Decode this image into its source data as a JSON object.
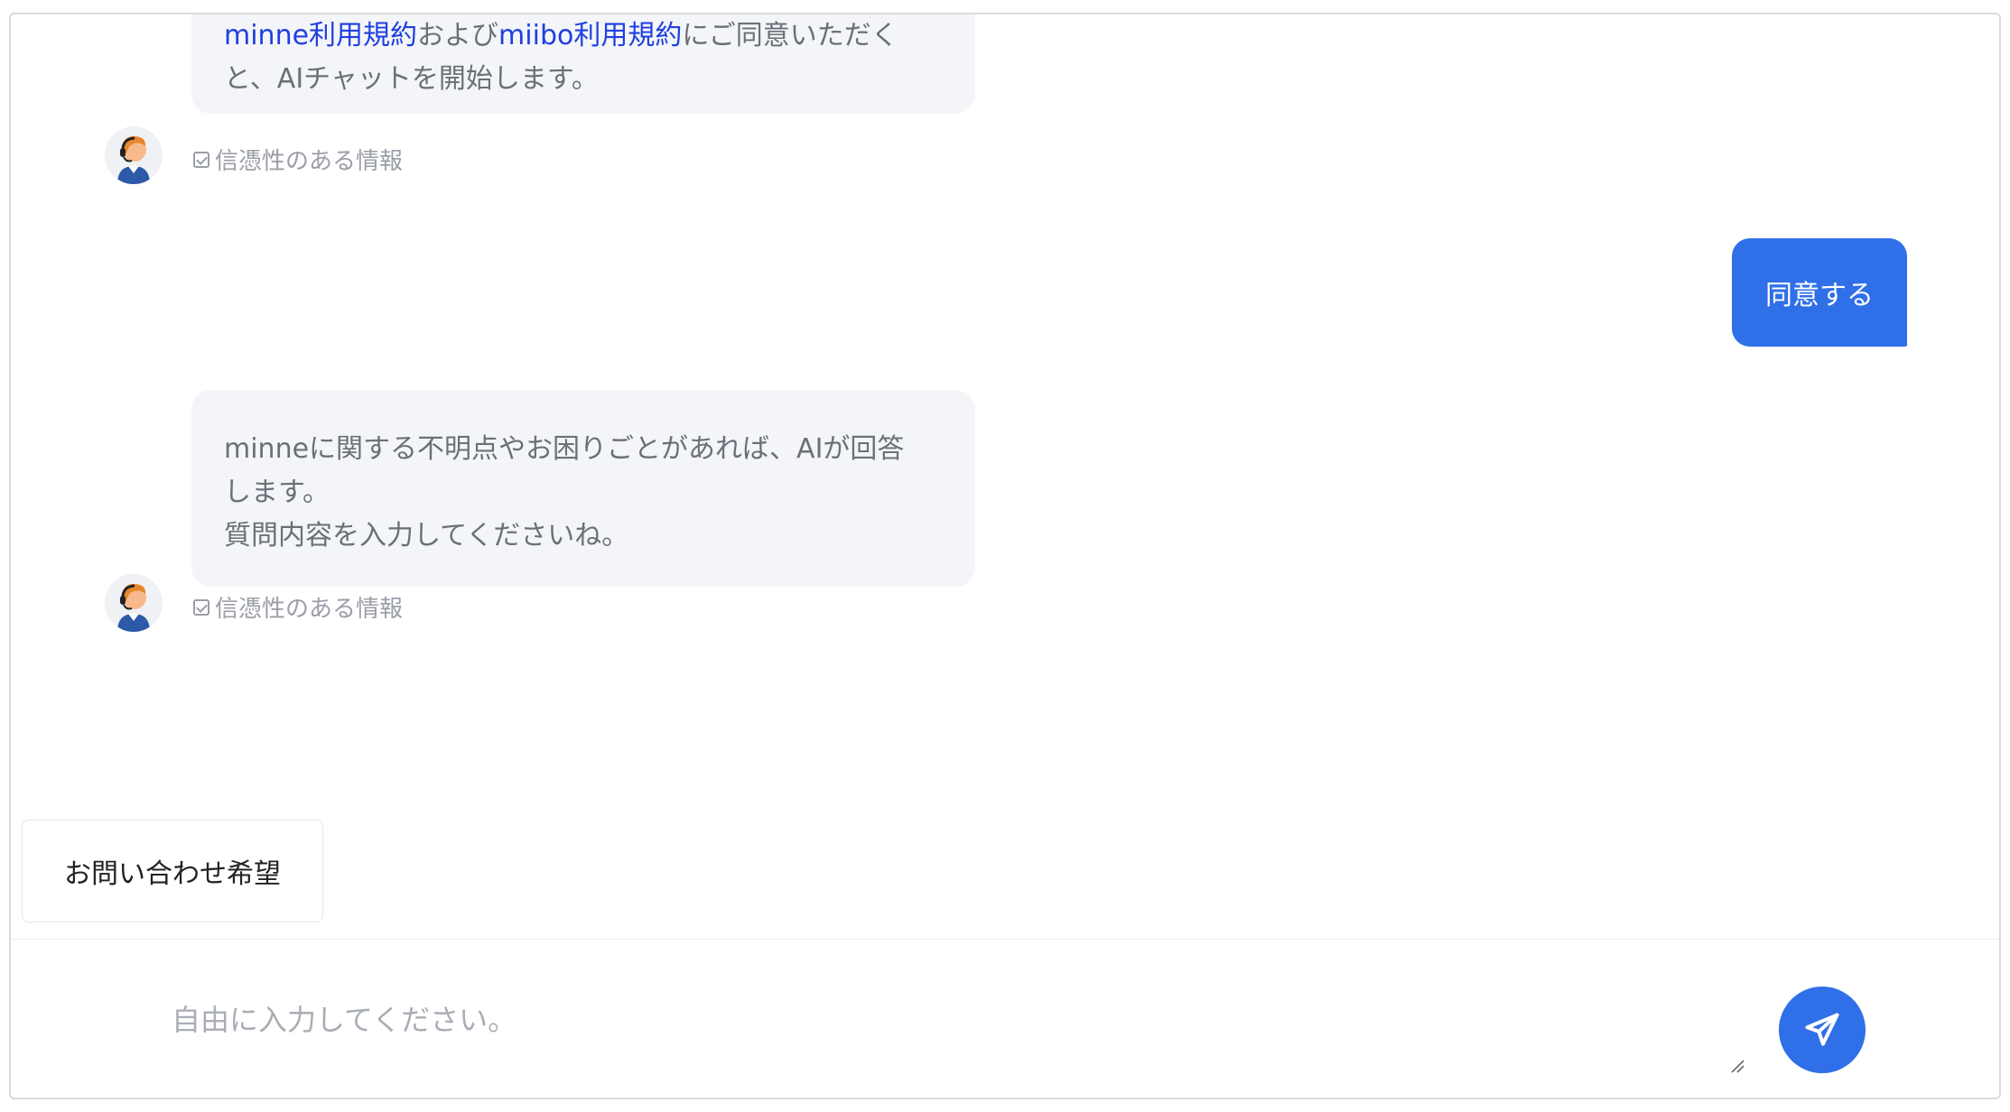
{
  "messages": {
    "bot_1": {
      "link_1": "minne利用規約",
      "text_1": "および",
      "link_2": "miibo利用規約",
      "text_2": "にご同意いただく",
      "line_2": "と、AIチャットを開始します。",
      "credibility": "信憑性のある情報"
    },
    "user_1": {
      "text": "同意する"
    },
    "bot_2": {
      "line_1": "minneに関する不明点やお困りごとがあれば、AIが回答",
      "line_2": "します。",
      "line_3": "質問内容を入力してくださいね。",
      "credibility": "信憑性のある情報"
    }
  },
  "quick_reply": {
    "label": "お問い合わせ希望"
  },
  "input": {
    "placeholder": "自由に入力してください。",
    "value": ""
  },
  "colors": {
    "accent": "#2f6fe8",
    "link": "#1f3fe0",
    "bubble_bg": "#f4f5f8"
  },
  "icons": {
    "avatar": "support-agent-avatar",
    "send": "send-paper-plane-icon",
    "check": "checkbox-icon"
  }
}
